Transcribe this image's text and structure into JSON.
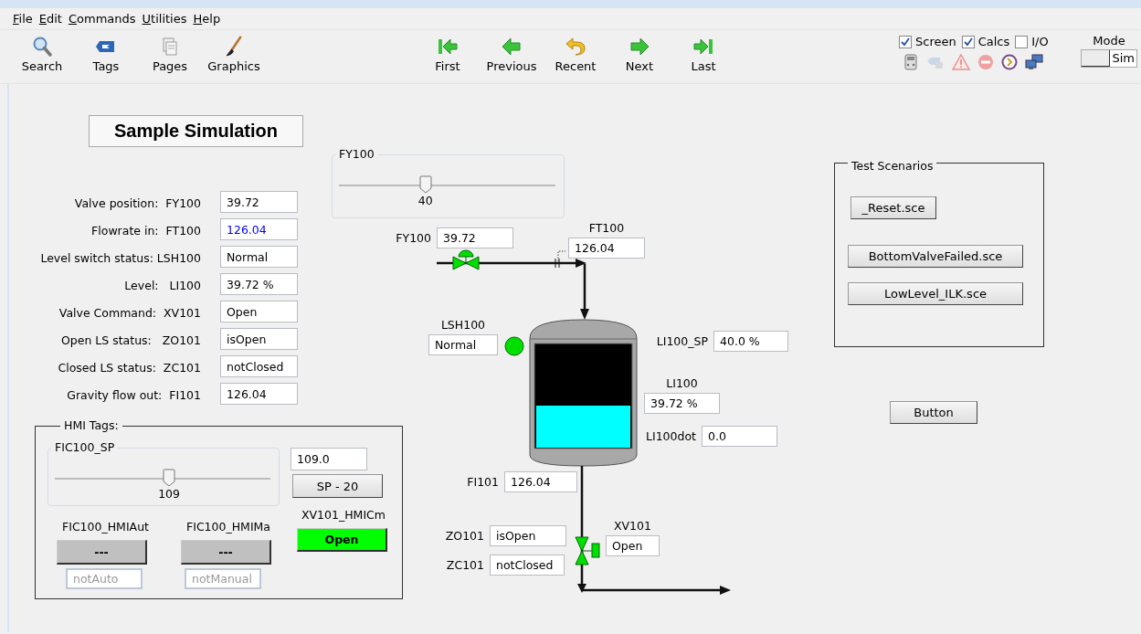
{
  "menu": [
    "File",
    "Edit",
    "Commands",
    "Utilities",
    "Help"
  ],
  "toolbar": {
    "tools": [
      {
        "label": "Search"
      },
      {
        "label": "Tags"
      },
      {
        "label": "Pages"
      },
      {
        "label": "Graphics"
      }
    ],
    "navigation": [
      {
        "label": "First"
      },
      {
        "label": "Previous"
      },
      {
        "label": "Recent"
      },
      {
        "label": "Next"
      },
      {
        "label": "Last"
      }
    ],
    "options": [
      {
        "label": "Screen",
        "checked": true
      },
      {
        "label": "Calcs",
        "checked": true
      },
      {
        "label": "I/O",
        "checked": false
      }
    ],
    "mode": {
      "label": "Mode",
      "value": "Sim"
    }
  },
  "title": "Sample Simulation",
  "tag_list": [
    {
      "label": "Valve position:  FY100",
      "value": "39.72",
      "color": "#000000"
    },
    {
      "label": "Flowrate in:  FT100",
      "value": "126.04",
      "color": "#0000ff"
    },
    {
      "label": "Level switch status: LSH100",
      "value": "Normal",
      "color": "#000000"
    },
    {
      "label": "Level:   LI100",
      "value": "39.72 %",
      "color": "#000000"
    },
    {
      "label": "Valve Command:  XV101",
      "value": "Open",
      "color": "#000000"
    },
    {
      "label": "Open LS status:   ZO101",
      "value": "isOpen",
      "color": "#000000"
    },
    {
      "label": "Closed LS status:  ZC101",
      "value": "notClosed",
      "color": "#000000"
    },
    {
      "label": "Gravity flow out:  FI101",
      "value": "126.04",
      "color": "#000000"
    }
  ],
  "hmi_tags": {
    "title": "HMI Tags:",
    "setpoint": {
      "label": "FIC100_SP",
      "level": 0.53,
      "reading": "109"
    },
    "setpoint_value": "109.0",
    "sp_button": "SP - 20",
    "auto": {
      "label": "FIC100_HMIAut",
      "button": "---",
      "status": "notAuto",
      "disabled": true
    },
    "manual": {
      "label": "FIC100_HMIMa",
      "button": "---",
      "status": "notManual",
      "disabled": true
    },
    "valve_command": {
      "label": "XV101_HMICm",
      "button": "Open",
      "on": true
    }
  },
  "diagram": {
    "valve_slider": {
      "label": "FY100",
      "level": 0.4,
      "reading": "40"
    },
    "tags": [
      {
        "label": "FY100",
        "value": "39.72"
      },
      {
        "label": "FT100",
        "value": "126.04"
      },
      {
        "label": "LSH100",
        "value": "Normal"
      },
      {
        "label": "LI100_SP",
        "value": "40.0 %"
      },
      {
        "label": "LI100",
        "value": "39.72 %"
      },
      {
        "label": "LI100dot",
        "value": "0.0"
      },
      {
        "label": "FI101",
        "value": "126.04"
      },
      {
        "label": "ZO101",
        "value": "isOpen"
      },
      {
        "label": "ZC101",
        "value": "notClosed"
      },
      {
        "label": "XV101",
        "value": "Open"
      }
    ],
    "level_switch_alarm": false
  },
  "test_scenarios": {
    "title": "Test Scenarios",
    "buttons": [
      "_Reset.sce",
      "BottomValveFailed.sce",
      "LowLevel_ILK.sce"
    ]
  },
  "button": "Button"
}
